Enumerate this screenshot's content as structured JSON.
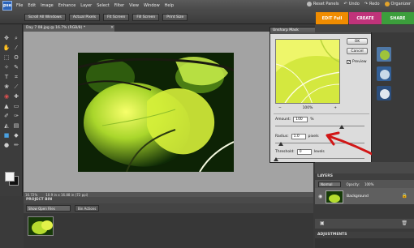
{
  "app": {
    "logo": "pse"
  },
  "menu": [
    "File",
    "Edit",
    "Image",
    "Enhance",
    "Layer",
    "Select",
    "Filter",
    "View",
    "Window",
    "Help"
  ],
  "menu_right": {
    "reset_panels": "Reset Panels",
    "undo": "Undo",
    "redo": "Redo",
    "organizer": "Organizer"
  },
  "options_bar": {
    "buttons": [
      "Scroll All Windows",
      "Actual Pixels",
      "Fit Screen",
      "Fill Screen",
      "Print Size"
    ]
  },
  "mode_tabs": {
    "edit_full": "EDIT Full",
    "create": "CREATE",
    "share": "SHARE"
  },
  "document": {
    "tab_title": "Day 7 08.jpg @ 16.7% (RGB/8) *",
    "zoom": "16.72%",
    "status": "16.72%",
    "doc_info": "10.9 in x 16.88 in (72 ppi)"
  },
  "dialog": {
    "title": "Unsharp Mask",
    "ok": "OK",
    "cancel": "Cancel",
    "preview_label": "Preview",
    "preview_checked": true,
    "zoom": "100%",
    "amount_label": "Amount:",
    "amount_value": "100",
    "amount_unit": "%",
    "radius_label": "Radius:",
    "radius_value": "1.0",
    "radius_unit": "pixels",
    "threshold_label": "Threshold:",
    "threshold_value": "0",
    "threshold_unit": "levels"
  },
  "project_bin": {
    "title": "PROJECT BIN",
    "show_select": "Show Open Files",
    "actions": "Bin Actions"
  },
  "layers": {
    "title": "LAYERS",
    "blend_mode": "Normal",
    "opacity_label": "Opacity:",
    "opacity_value": "100%",
    "layer_name": "Background"
  },
  "effects": {
    "apply": "Apply"
  },
  "adjustments": {
    "title": "ADJUSTMENTS"
  },
  "colors": {
    "accent_orange": "#f08c00",
    "create_pink": "#c0337a",
    "share_green": "#3c9e3c",
    "annotation_red": "#d11616"
  }
}
